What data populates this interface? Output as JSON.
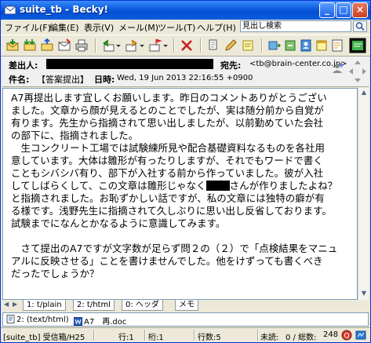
{
  "window": {
    "title": "suite_tb - Becky!"
  },
  "titlebar_buttons": {
    "minimize": "_",
    "maximize": "□",
    "close": "×"
  },
  "menu": {
    "items": [
      "ファイル(F)",
      "編集(E)",
      "表示(V)",
      "メール(M)",
      "ツール(T)",
      "ヘルプ(H)"
    ],
    "search_placeholder": "見出し検索"
  },
  "toolbar": {
    "icons": [
      "receive-mail-icon",
      "receive-all-icon",
      "send-mail-icon",
      "new-mail-icon",
      "print-icon",
      "reply-icon",
      "forward-icon",
      "flag-icon",
      "delete-icon",
      "filter-icon",
      "edit-icon",
      "note-icon",
      "template-icon",
      "sort-icon",
      "address-book-icon",
      "calendar-icon",
      "reminder-icon",
      "view-icon"
    ]
  },
  "header": {
    "from_label": "差出人:",
    "to_label": "宛先:",
    "to_value": "<tb@brain-center.co.jp>",
    "subject_label": "件名:",
    "subject_value": "【答案提出】",
    "date_label": "日時:",
    "date_value": "Wed, 19 Jun 2013 22:16:55 +0900"
  },
  "body": {
    "lines": [
      "A7再提出します宜しくお願いします。昨日のコメントありがとうござい",
      "ました。文章から顔が見えるとのことでしたが、実は随分前から自覚が",
      "有ります。先生から指摘されて思い出しましたが、以前勤めていた会社",
      "の部下に、指摘されました。",
      "　生コンクリート工場では試験練所見や配合基礎資料なるものを各社用",
      "意しています。大体は雛形が有ったりしますが、それでもワードで書く",
      "こともシバシバ有り、部下が入社する前から作っていました。彼が入社",
      "してしばらくして、この文章は雛形じゃなく",
      "さんが作りましたよね？",
      "と指摘されました。お恥ずかしい話ですが、私の文章には独特の癖が有",
      "る様です。浅野先生に指摘されて久しぶりに思い出し反省しております。",
      "試験までになんとかなるように意識してみます。",
      "",
      "　さて提出のA7ですが文字数が足らず問２の（２）で「点検結果をマニュ",
      "アルに反映させる」ことを書けませんでした。他をけずっても書くべき",
      "だったでしょうか？"
    ]
  },
  "tabs": {
    "items": [
      "1: t/plain",
      "2: t/html",
      "0: ヘッダ",
      "メモ"
    ]
  },
  "attachments": {
    "items": [
      "2: (text/html)",
      "A7　再.doc"
    ]
  },
  "status": {
    "folder": "[suite_tb] 受信箱/H25",
    "line": "行:1",
    "column": "桁:1",
    "line_count": "行数:5",
    "unread": "未読:",
    "total": "0 / 総数:",
    "total_value": "248"
  },
  "colors": {
    "titlebar": "#0a5ce0",
    "window_bg": "#ece9d8",
    "body_bg": "#ffffff",
    "redaction": "#000000"
  }
}
